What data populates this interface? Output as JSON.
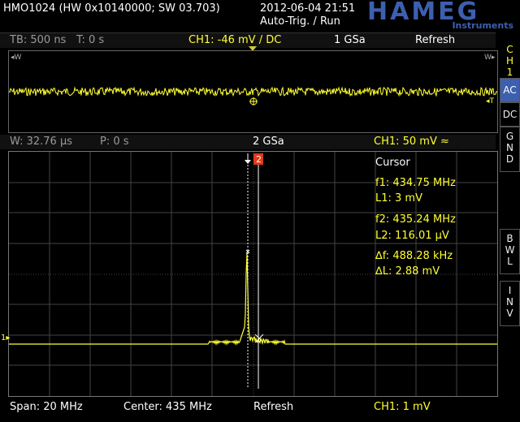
{
  "header": {
    "device": "HMO1024 (HW 0x10140000; SW 03.703)",
    "datetime": "2012-06-04 21:51",
    "status": "Auto-Trig. / Run",
    "brand": "HAMEG",
    "brand_sub": "Instruments"
  },
  "topbar": {
    "timebase": "TB: 500 ns",
    "time": "T: 0 s",
    "channel": "CH1: -46 mV / DC",
    "samplerate": "1 GSa",
    "mode": "Refresh"
  },
  "zoombar": {
    "window": "W: 32.76 µs",
    "position": "P: 0 s",
    "samplerate": "2 GSa",
    "channel": "CH1: 50 mV ≈"
  },
  "cursor": {
    "title": "Cursor",
    "f1": "f1: 434.75 MHz",
    "l1": "L1: 3 mV",
    "f2": "f2: 435.24 MHz",
    "l2": "L2: 116.01 µV",
    "df": "∆f: 488.28 kHz",
    "dl": "∆L: 2.88 mV",
    "marker2": "2"
  },
  "bottombar": {
    "span": "Span: 20 MHz",
    "center": "Center: 435 MHz",
    "mode": "Refresh",
    "channel": "CH1: 1 mV"
  },
  "sidebar": {
    "ch_label": [
      "C",
      "H",
      "1"
    ],
    "ac": "AC",
    "dc": "DC",
    "gnd": [
      "G",
      "N",
      "D"
    ],
    "bwl": [
      "B",
      "W",
      "L"
    ],
    "inv": [
      "I",
      "N",
      "V"
    ]
  },
  "markers": {
    "w_left": "W",
    "w_right": "W",
    "ch_marker": "1",
    "t_marker": "T"
  },
  "colors": {
    "trace": "#ffff33",
    "accent": "#3d5fae",
    "grid": "#444444"
  }
}
